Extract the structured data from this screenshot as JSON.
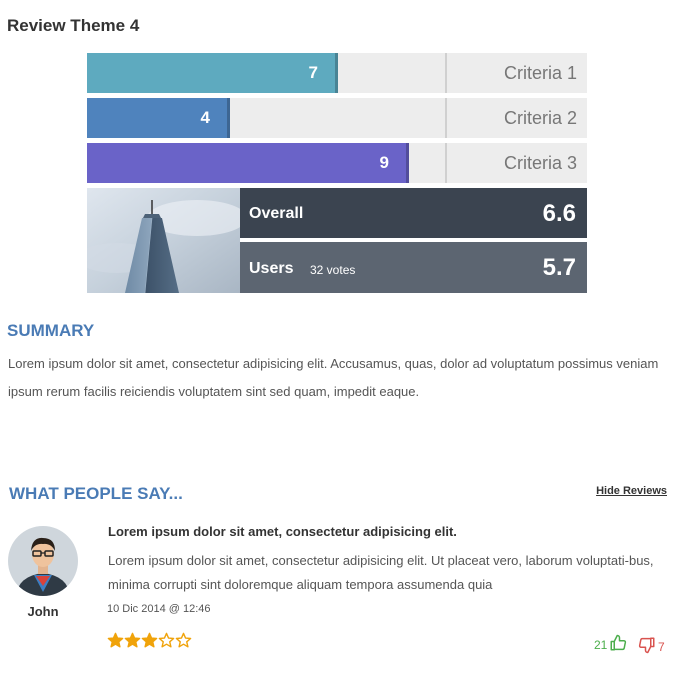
{
  "theme_title": "Review Theme 4",
  "criteria": [
    {
      "label": "Criteria 1",
      "value": "7",
      "score": 7,
      "color": "#5eaabf"
    },
    {
      "label": "Criteria 2",
      "value": "4",
      "score": 4,
      "color": "#4f83bd"
    },
    {
      "label": "Criteria 3",
      "value": "9",
      "score": 9,
      "color": "#6a63c8"
    }
  ],
  "overall": {
    "label": "Overall",
    "value": "6.6",
    "bg": "#3b4450"
  },
  "users": {
    "label": "Users",
    "votes": "32 votes",
    "value": "5.7",
    "bg": "#5c6571"
  },
  "summary": {
    "heading": "SUMMARY",
    "text": "Lorem ipsum dolor sit amet, consectetur adipisicing elit. Accusamus, quas, dolor ad voluptatum possimus veniam ipsum rerum facilis reiciendis voluptatem sint sed quam, impedit eaque."
  },
  "reviews_section": {
    "heading": "WHAT PEOPLE SAY...",
    "hide_label": "Hide Reviews"
  },
  "review": {
    "author": "John",
    "title": "Lorem ipsum dolor sit amet, consectetur adipisicing elit.",
    "text": "Lorem ipsum dolor sit amet, consectetur adipisicing elit. Ut placeat vero, laborum voluptati-bus, minima corrupti sint doloremque aliquam tempora assumenda quia",
    "date": "10 Dic 2014 @ 12:46",
    "rating": 3,
    "rating_max": 5,
    "star_color": "#f0a30a",
    "likes": "21",
    "dislikes": "7"
  }
}
